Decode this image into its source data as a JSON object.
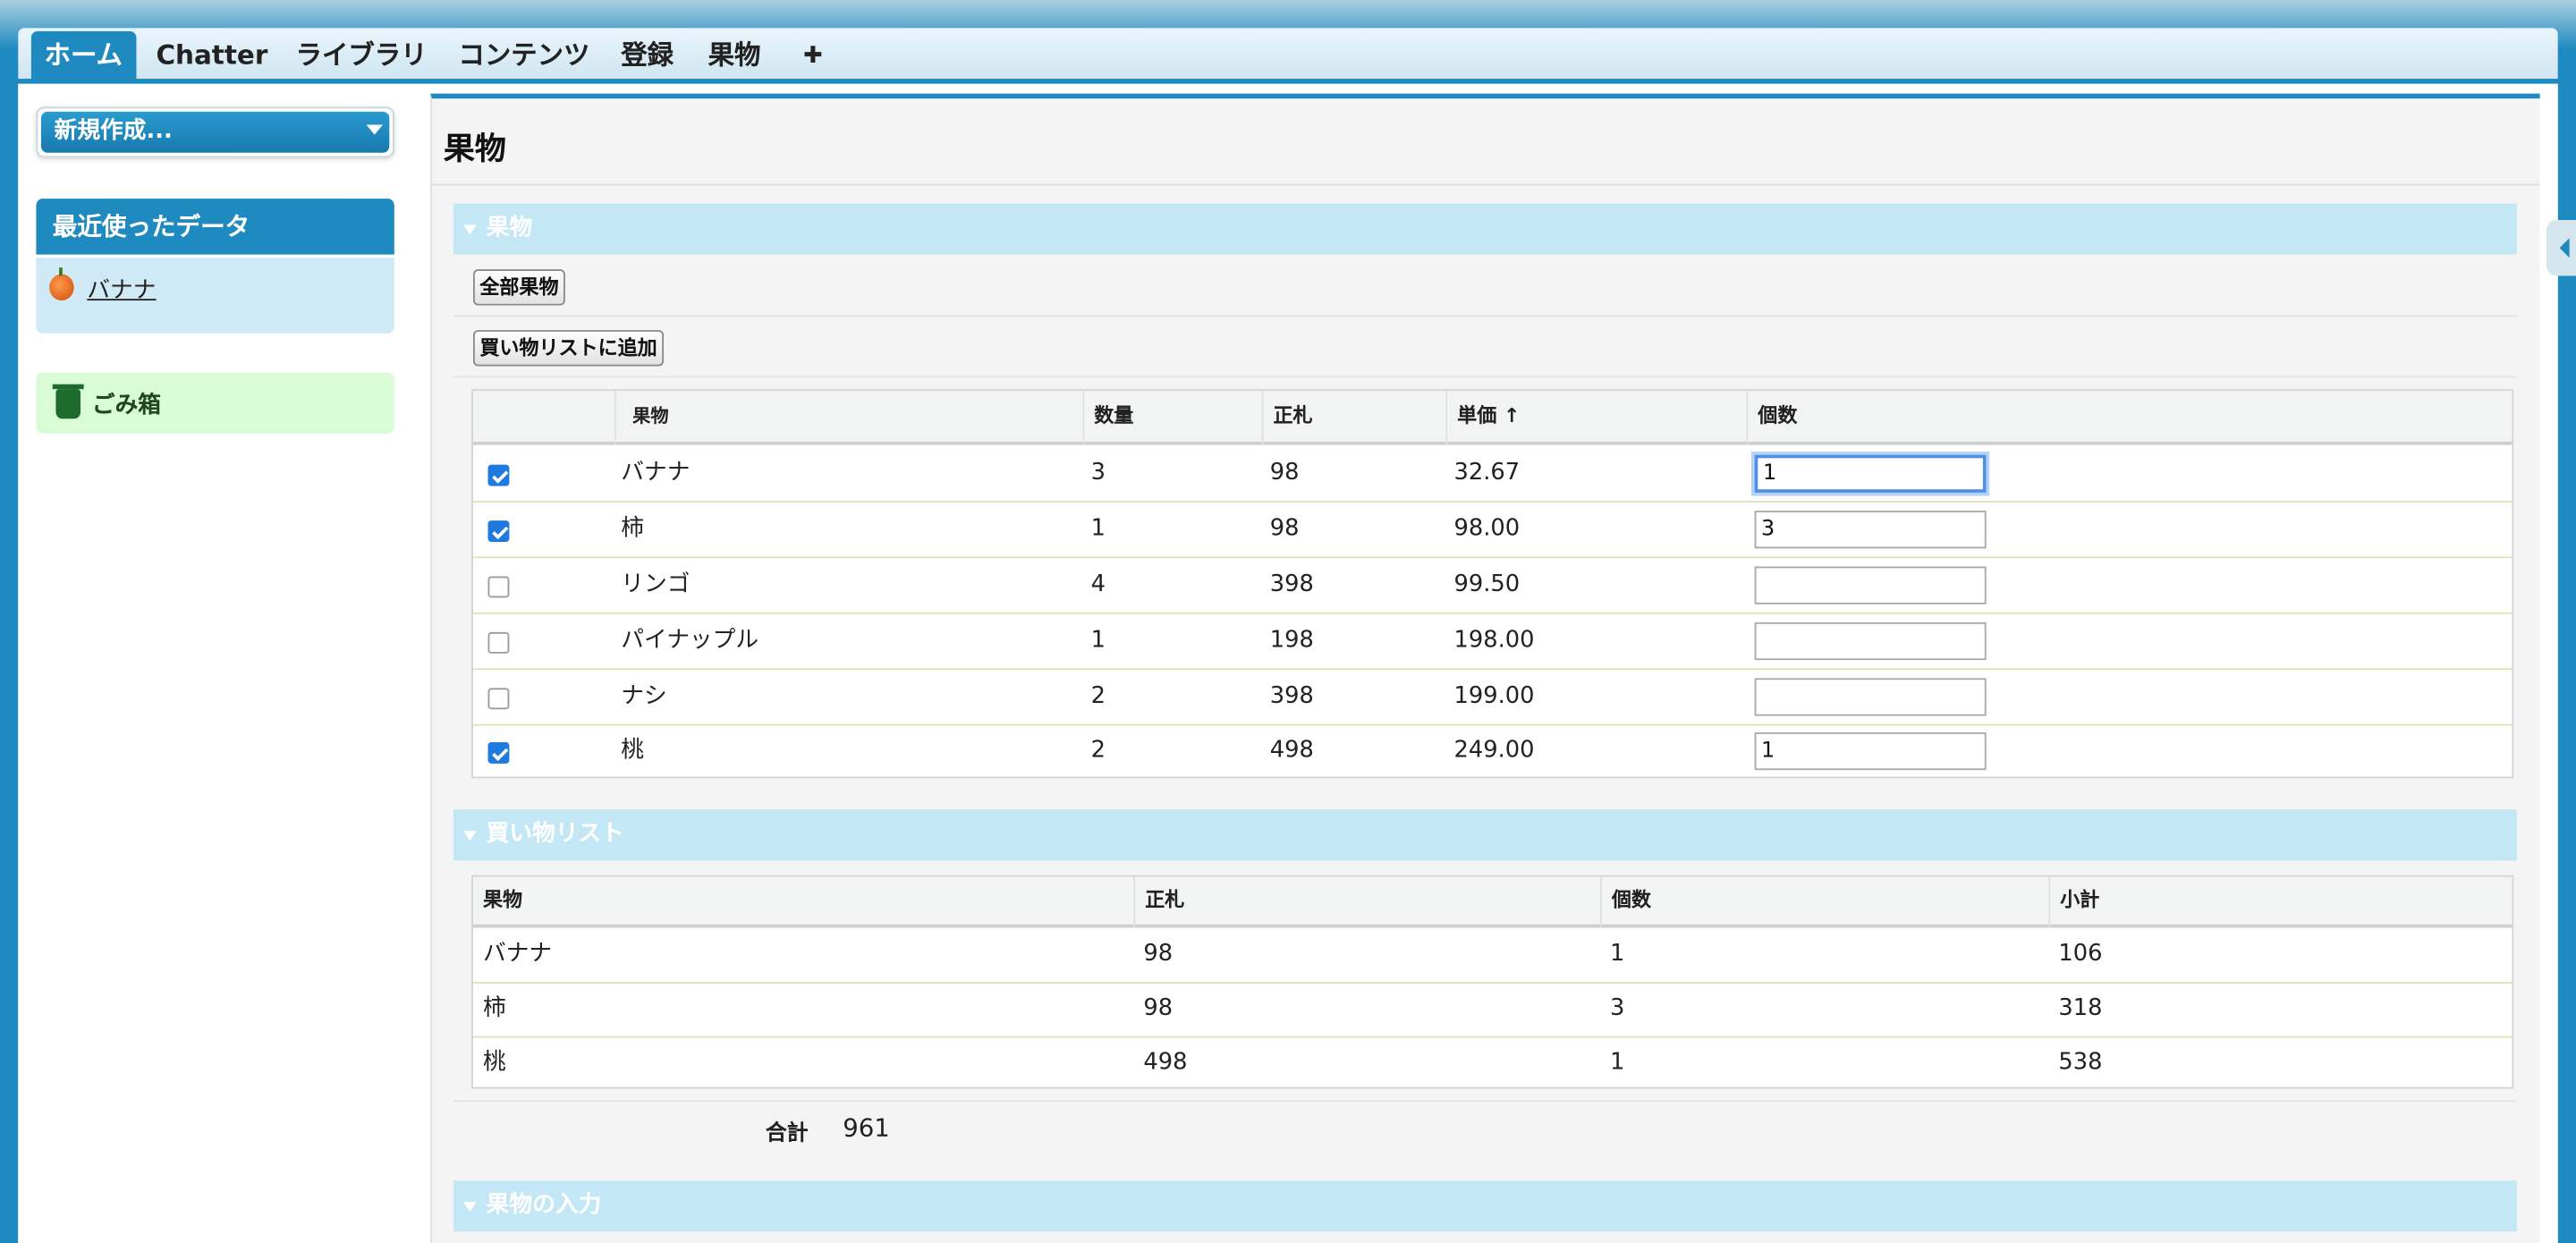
{
  "tabs": [
    {
      "label": "ホーム",
      "active": true
    },
    {
      "label": "Chatter"
    },
    {
      "label": "ライブラリ"
    },
    {
      "label": "コンテンツ"
    },
    {
      "label": "登録"
    },
    {
      "label": "果物"
    },
    {
      "label": "✚"
    }
  ],
  "sidebar": {
    "new_button_label": "新規作成...",
    "recent_title": "最近使ったデータ",
    "recent_items": [
      "バナナ"
    ],
    "trash_label": "ごみ箱"
  },
  "main": {
    "page_title": "果物",
    "fruit_section": {
      "title": "果物",
      "all_button": "全部果物",
      "add_button": "買い物リストに追加",
      "columns": [
        "",
        "果物",
        "数量",
        "正札",
        "単価 ↑",
        "個数"
      ],
      "rows": [
        {
          "checked": true,
          "name": "バナナ",
          "quantity": "3",
          "price": "98",
          "unit_price": "32.67",
          "count": "1",
          "focused": true
        },
        {
          "checked": true,
          "name": "柿",
          "quantity": "1",
          "price": "98",
          "unit_price": "98.00",
          "count": "3"
        },
        {
          "checked": false,
          "name": "リンゴ",
          "quantity": "4",
          "price": "398",
          "unit_price": "99.50",
          "count": ""
        },
        {
          "checked": false,
          "name": "パイナップル",
          "quantity": "1",
          "price": "198",
          "unit_price": "198.00",
          "count": ""
        },
        {
          "checked": false,
          "name": "ナシ",
          "quantity": "2",
          "price": "398",
          "unit_price": "199.00",
          "count": ""
        },
        {
          "checked": true,
          "name": "桃",
          "quantity": "2",
          "price": "498",
          "unit_price": "249.00",
          "count": "1"
        }
      ]
    },
    "shopping_section": {
      "title": "買い物リスト",
      "columns": [
        "果物",
        "正札",
        "個数",
        "小計"
      ],
      "rows": [
        {
          "name": "バナナ",
          "price": "98",
          "count": "1",
          "subtotal": "106"
        },
        {
          "name": "柿",
          "price": "98",
          "count": "3",
          "subtotal": "318"
        },
        {
          "name": "桃",
          "price": "498",
          "count": "1",
          "subtotal": "538"
        }
      ],
      "total_label": "合計",
      "total_value": "961"
    },
    "input_section": {
      "title": "果物の入力"
    }
  },
  "colors": {
    "brand_blue": "#1f8ac0",
    "section_header": "#c4e7f6",
    "trash_bg": "#d9fbd6",
    "checkbox_on": "#1f7ae0"
  }
}
